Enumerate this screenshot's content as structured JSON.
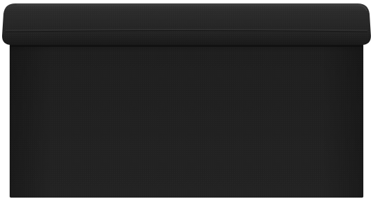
{
  "image": {
    "subject": "storage-ottoman",
    "background_color": "#ffffff",
    "colors": {
      "lid_top": "#2e2e2e",
      "lid_mid": "#262626",
      "lid_bottom": "#1d1d1d",
      "body_top": "#1f1f1f",
      "body_bottom": "#222222",
      "seam": "#3b3b3b"
    }
  }
}
